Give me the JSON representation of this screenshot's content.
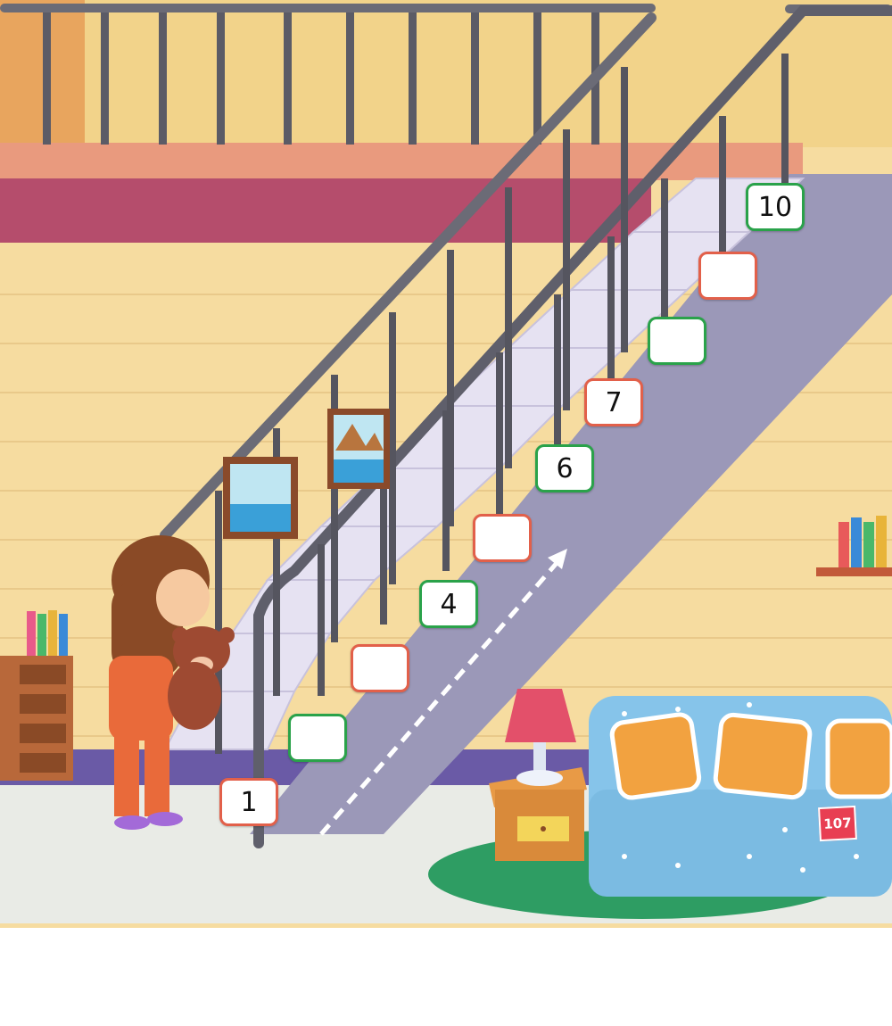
{
  "steps": [
    {
      "label": "1",
      "border": "#e2604a"
    },
    {
      "label": "",
      "border": "#2aa24a"
    },
    {
      "label": "",
      "border": "#e2604a"
    },
    {
      "label": "4",
      "border": "#2aa24a"
    },
    {
      "label": "",
      "border": "#e2604a"
    },
    {
      "label": "6",
      "border": "#2aa24a"
    },
    {
      "label": "7",
      "border": "#e2604a"
    },
    {
      "label": "",
      "border": "#2aa24a"
    },
    {
      "label": "",
      "border": "#e2604a"
    },
    {
      "label": "10",
      "border": "#2aa24a"
    }
  ],
  "page_number": "107",
  "colors": {
    "wall": "#f6dca0",
    "upper_wall": "#f2d38a",
    "floor": "#e9ebe6",
    "stair_stringer": "#9b98b8",
    "stair_steps": "#e6e2f2",
    "railing": "#6b6b76",
    "landing_beam": "#b54d6c",
    "sofa": "#86c4ea",
    "rug": "#2e9d63",
    "table": "#d98a3a",
    "lamp_shade": "#e3506a",
    "girl_outfit": "#e96a3a",
    "hair": "#8a4a26",
    "teddy": "#9e4a32"
  }
}
